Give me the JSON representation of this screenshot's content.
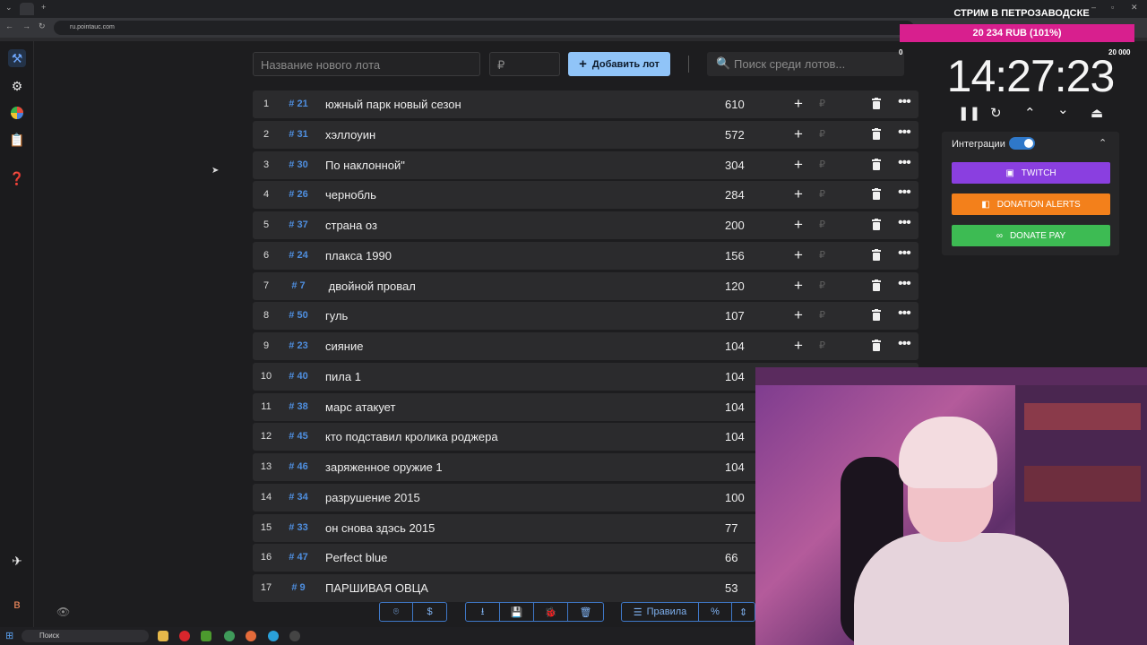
{
  "browser": {
    "url": "ru.pointauc.com",
    "new_tab": "+"
  },
  "toolbar": {
    "lot_placeholder": "Название нового лота",
    "price_placeholder": "₽",
    "add_label": "Добавить лот",
    "search_placeholder": "Поиск среди лотов..."
  },
  "lots": [
    {
      "num": "1",
      "id": "# 21",
      "name": "южный парк новый сезон",
      "amount": "610"
    },
    {
      "num": "2",
      "id": "# 31",
      "name": "хэллоуин",
      "amount": "572"
    },
    {
      "num": "3",
      "id": "# 30",
      "name": "По наклонной\"",
      "amount": "304"
    },
    {
      "num": "4",
      "id": "# 26",
      "name": "чернобль",
      "amount": "284"
    },
    {
      "num": "5",
      "id": "# 37",
      "name": "страна оз",
      "amount": "200"
    },
    {
      "num": "6",
      "id": "# 24",
      "name": "плакса 1990",
      "amount": "156"
    },
    {
      "num": "7",
      "id": "# 7",
      "name": " двойной провал",
      "amount": "120"
    },
    {
      "num": "8",
      "id": "# 50",
      "name": "гуль",
      "amount": "107"
    },
    {
      "num": "9",
      "id": "# 23",
      "name": "сияние",
      "amount": "104"
    },
    {
      "num": "10",
      "id": "# 40",
      "name": "пила 1",
      "amount": "104"
    },
    {
      "num": "11",
      "id": "# 38",
      "name": "марс атакует",
      "amount": "104"
    },
    {
      "num": "12",
      "id": "# 45",
      "name": "кто подставил кролика роджера",
      "amount": "104"
    },
    {
      "num": "13",
      "id": "# 46",
      "name": "заряженное оружие 1",
      "amount": "104"
    },
    {
      "num": "14",
      "id": "# 34",
      "name": "разрушение 2015",
      "amount": "100"
    },
    {
      "num": "15",
      "id": "# 33",
      "name": "он снова здэсь 2015",
      "amount": "77"
    },
    {
      "num": "16",
      "id": "# 47",
      "name": "Perfect blue",
      "amount": "66"
    },
    {
      "num": "17",
      "id": "# 9",
      "name": "ПАРШИВАЯ ОВЦА",
      "amount": "53"
    }
  ],
  "row_actions": {
    "plus": "+",
    "rub": "₽",
    "more": "•••"
  },
  "bottom_toolbar": {
    "rules_label": "Правила",
    "percent_label": "%",
    "dollar_label": "$"
  },
  "stream": {
    "title": "СТРИМ В ПЕТРОЗАВОДСКЕ",
    "goal_text": "20 234 RUB (101%)",
    "goal_min": "0",
    "goal_max": "20 000",
    "goal_progress": 1.0
  },
  "timer": {
    "value": "14:27:23"
  },
  "integrations": {
    "label": "Интеграции",
    "enabled": true,
    "twitch": "TWITCH",
    "donation_alerts": "DONATION ALERTS",
    "donate_pay": "DONATE PAY"
  },
  "taskbar": {
    "search": "Поиск"
  },
  "colors": {
    "accent": "#90c4f8",
    "goal_bar": "#d81f8e",
    "twitch": "#8a3fe0",
    "donation_alerts": "#f3801b",
    "donate_pay": "#3dbb53",
    "lot_id": "#4f8fe0"
  }
}
